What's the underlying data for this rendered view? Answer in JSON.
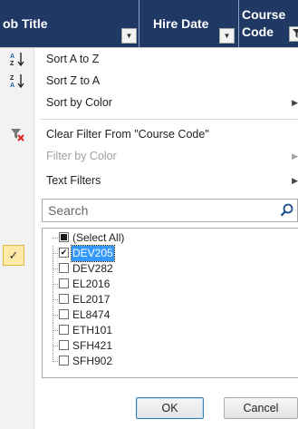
{
  "header": {
    "col1_title": "ob Title",
    "col2_title": "Hire Date",
    "col3_title_line1": "Course",
    "col3_title_line2": "Code",
    "dropdown_glyph": "▼",
    "colors": {
      "header_bg": "#1f3864",
      "header_text": "#ffffff"
    }
  },
  "menu": {
    "items": [
      {
        "label": "Sort A to Z",
        "icon": "sort-ascending-icon",
        "icon_text": "A↓",
        "disabled": false,
        "submenu": false
      },
      {
        "label": "Sort Z to A",
        "icon": "sort-descending-icon",
        "icon_text": "Z↓",
        "disabled": false,
        "submenu": false
      },
      {
        "label": "Sort by Color",
        "icon": "",
        "icon_text": "",
        "disabled": false,
        "submenu": true
      },
      {
        "label": "Clear Filter From \"Course Code\"",
        "icon": "clear-filter-icon",
        "icon_text": "",
        "disabled": false,
        "submenu": false
      },
      {
        "label": "Filter by Color",
        "icon": "",
        "icon_text": "",
        "disabled": true,
        "submenu": true
      },
      {
        "label": "Text Filters",
        "icon": "",
        "icon_text": "",
        "disabled": false,
        "submenu": true
      }
    ],
    "submenu_arrow": "▶"
  },
  "search": {
    "placeholder": "Search",
    "value": ""
  },
  "active_filter_glyph": "✓",
  "list": {
    "items": [
      {
        "label": "(Select All)",
        "state": "indeterminate",
        "selected": false
      },
      {
        "label": "DEV205",
        "state": "checked",
        "selected": true
      },
      {
        "label": "DEV282",
        "state": "unchecked",
        "selected": false
      },
      {
        "label": "EL2016",
        "state": "unchecked",
        "selected": false
      },
      {
        "label": "EL2017",
        "state": "unchecked",
        "selected": false
      },
      {
        "label": "EL8474",
        "state": "unchecked",
        "selected": false
      },
      {
        "label": "ETH101",
        "state": "unchecked",
        "selected": false
      },
      {
        "label": "SFH421",
        "state": "unchecked",
        "selected": false
      },
      {
        "label": "SFH902",
        "state": "unchecked",
        "selected": false
      }
    ],
    "check_glyph": "✔"
  },
  "buttons": {
    "ok": "OK",
    "cancel": "Cancel"
  }
}
